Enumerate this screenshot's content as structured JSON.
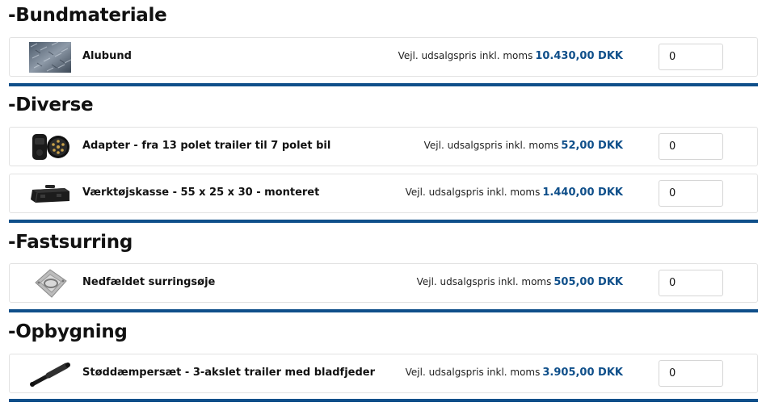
{
  "sections": [
    {
      "title": "-Bundmateriale",
      "items": [
        {
          "name": "Alubund",
          "price_label": "Vejl. udsalgspris inkl. moms",
          "price": "10.430,00 DKK",
          "qty": "0",
          "icon": "aluminium-floor-icon"
        }
      ]
    },
    {
      "title": "-Diverse",
      "items": [
        {
          "name": "Adapter - fra 13 polet trailer til 7 polet bil",
          "price_label": "Vejl. udsalgspris inkl. moms",
          "price": "52,00 DKK",
          "qty": "0",
          "icon": "plug-adapter-icon"
        },
        {
          "name": "Værktøjskasse - 55 x 25 x 30 - monteret",
          "price_label": "Vejl. udsalgspris inkl. moms",
          "price": "1.440,00 DKK",
          "qty": "0",
          "icon": "toolbox-icon"
        }
      ]
    },
    {
      "title": "-Fastsurring",
      "items": [
        {
          "name": "Nedfældet surringsøje",
          "price_label": "Vejl. udsalgspris inkl. moms",
          "price": "505,00 DKK",
          "qty": "0",
          "icon": "lashing-ring-icon"
        }
      ]
    },
    {
      "title": "-Opbygning",
      "items": [
        {
          "name": "Støddæmpersæt - 3-akslet trailer med bladfjeder",
          "price_label": "Vejl. udsalgspris inkl. moms",
          "price": "3.905,00 DKK",
          "qty": "0",
          "icon": "shock-absorber-icon"
        }
      ]
    }
  ],
  "colors": {
    "accent": "#0f4f8a",
    "divider": "#0f4f8a",
    "card_border": "#e2e2e2"
  }
}
